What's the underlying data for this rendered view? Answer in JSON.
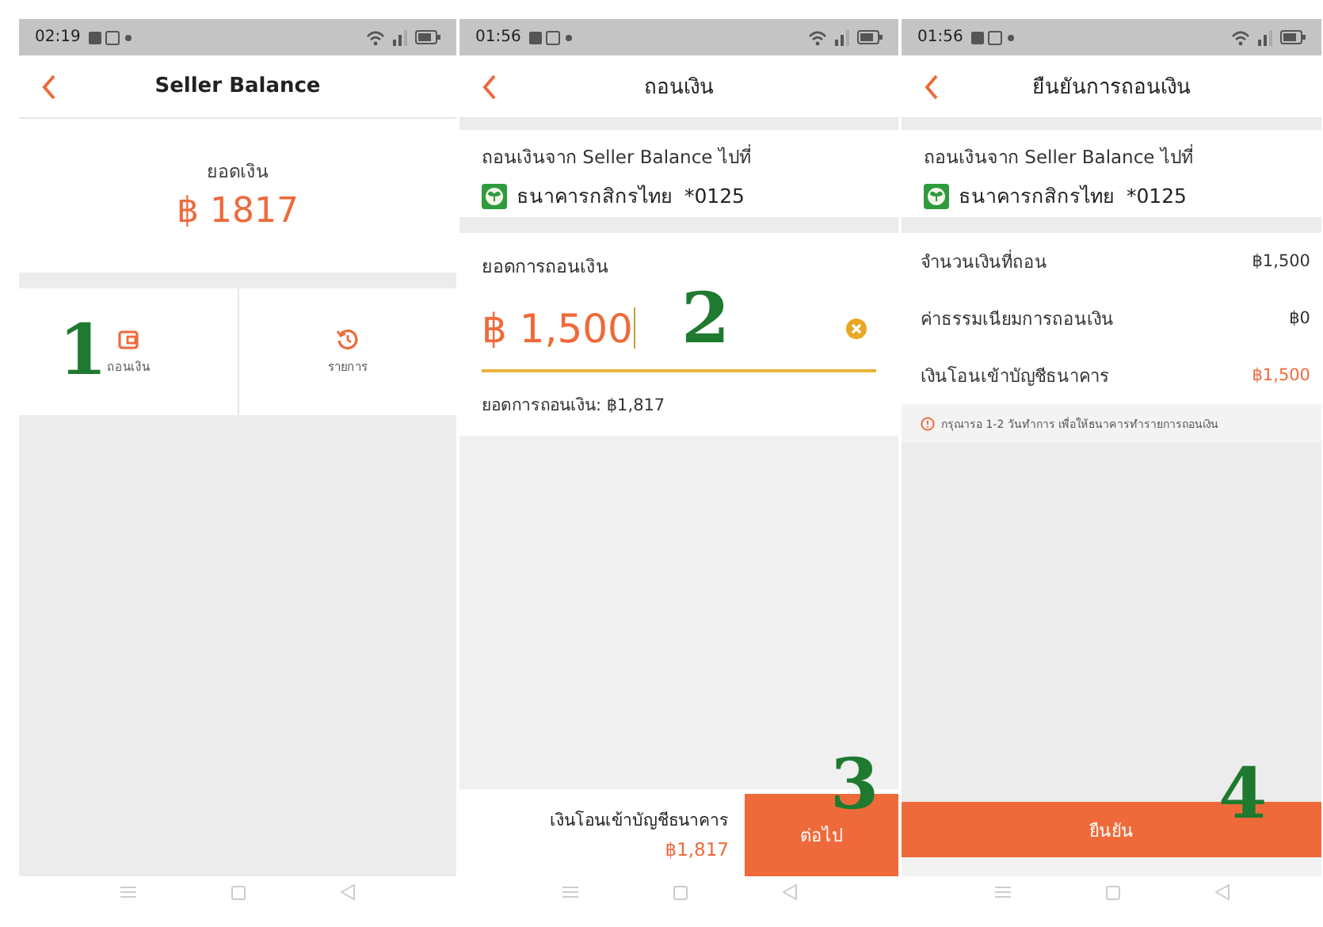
{
  "screens": [
    {
      "kind": "balance",
      "status_time": "02:19",
      "title": "Seller Balance",
      "balance_label": "ยอดเงิน",
      "balance": "฿ 1817",
      "actions": [
        {
          "label": "ถอนเงิน",
          "step": "1"
        },
        {
          "label": "รายการ"
        }
      ]
    },
    {
      "kind": "withdraw",
      "status_time": "01:56",
      "title": "ถอนเงิน",
      "source_label": "ถอนเงินจาก Seller Balance ไปที่",
      "bank": "ธนาคารกสิกรไทย  *0125",
      "amount_label": "ยอดการถอนเงิน",
      "amount_value": "฿ 1,500",
      "amount_step": "2",
      "available": "ยอดการถอนเงิน: ฿1,817",
      "footer": {
        "label": "เงินโอนเข้าบัญชีธนาคาร",
        "amount": "฿1,817",
        "button": "ต่อไป",
        "step": "3"
      }
    },
    {
      "kind": "confirm",
      "status_time": "01:56",
      "title": "ยืนยันการถอนเงิน",
      "source_label": "ถอนเงินจาก Seller Balance ไปที่",
      "bank": "ธนาคารกสิกรไทย  *0125",
      "rows": [
        {
          "label": "จำนวนเงินที่ถอน",
          "value": "฿1,500",
          "highlight": false
        },
        {
          "label": "ค่าธรรมเนียมการถอนเงิน",
          "value": "฿0",
          "highlight": false
        },
        {
          "label": "เงินโอนเข้าบัญชีธนาคาร",
          "value": "฿1,500",
          "highlight": true
        }
      ],
      "note": "กรุณารอ 1-2 วันทำการ เพื่อให้ธนาคารทำรายการถอนเงิน",
      "button": "ยืนยัน",
      "step": "4"
    }
  ]
}
